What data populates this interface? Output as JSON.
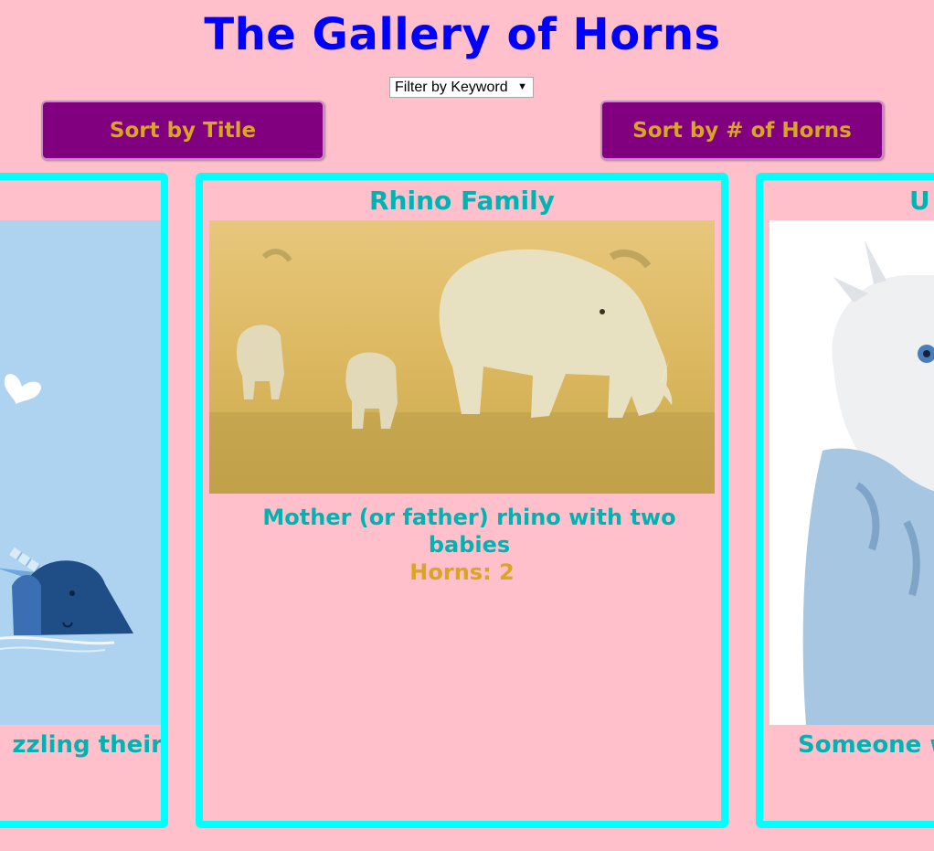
{
  "header": {
    "title": "The Gallery of Horns"
  },
  "filter": {
    "label": "Filter by Keyword",
    "caret": "▼"
  },
  "sort_buttons": {
    "title": "Sort by Title",
    "horns": "Sort by # of Horns"
  },
  "cards": [
    {
      "title": "",
      "description": "zzling their",
      "horns_text": ""
    },
    {
      "title": "Rhino Family",
      "description": "Mother (or father) rhino with two babies",
      "horns_text": "Horns: 2"
    },
    {
      "title": "U",
      "description": "Someone w",
      "horns_text": ""
    }
  ],
  "colors": {
    "background": "#ffc0cb",
    "title": "#0000ff",
    "button_bg": "#800080",
    "button_text": "#daa520",
    "card_border": "#00ffff",
    "card_text": "#00b3b3",
    "horns_text": "#daa520"
  }
}
